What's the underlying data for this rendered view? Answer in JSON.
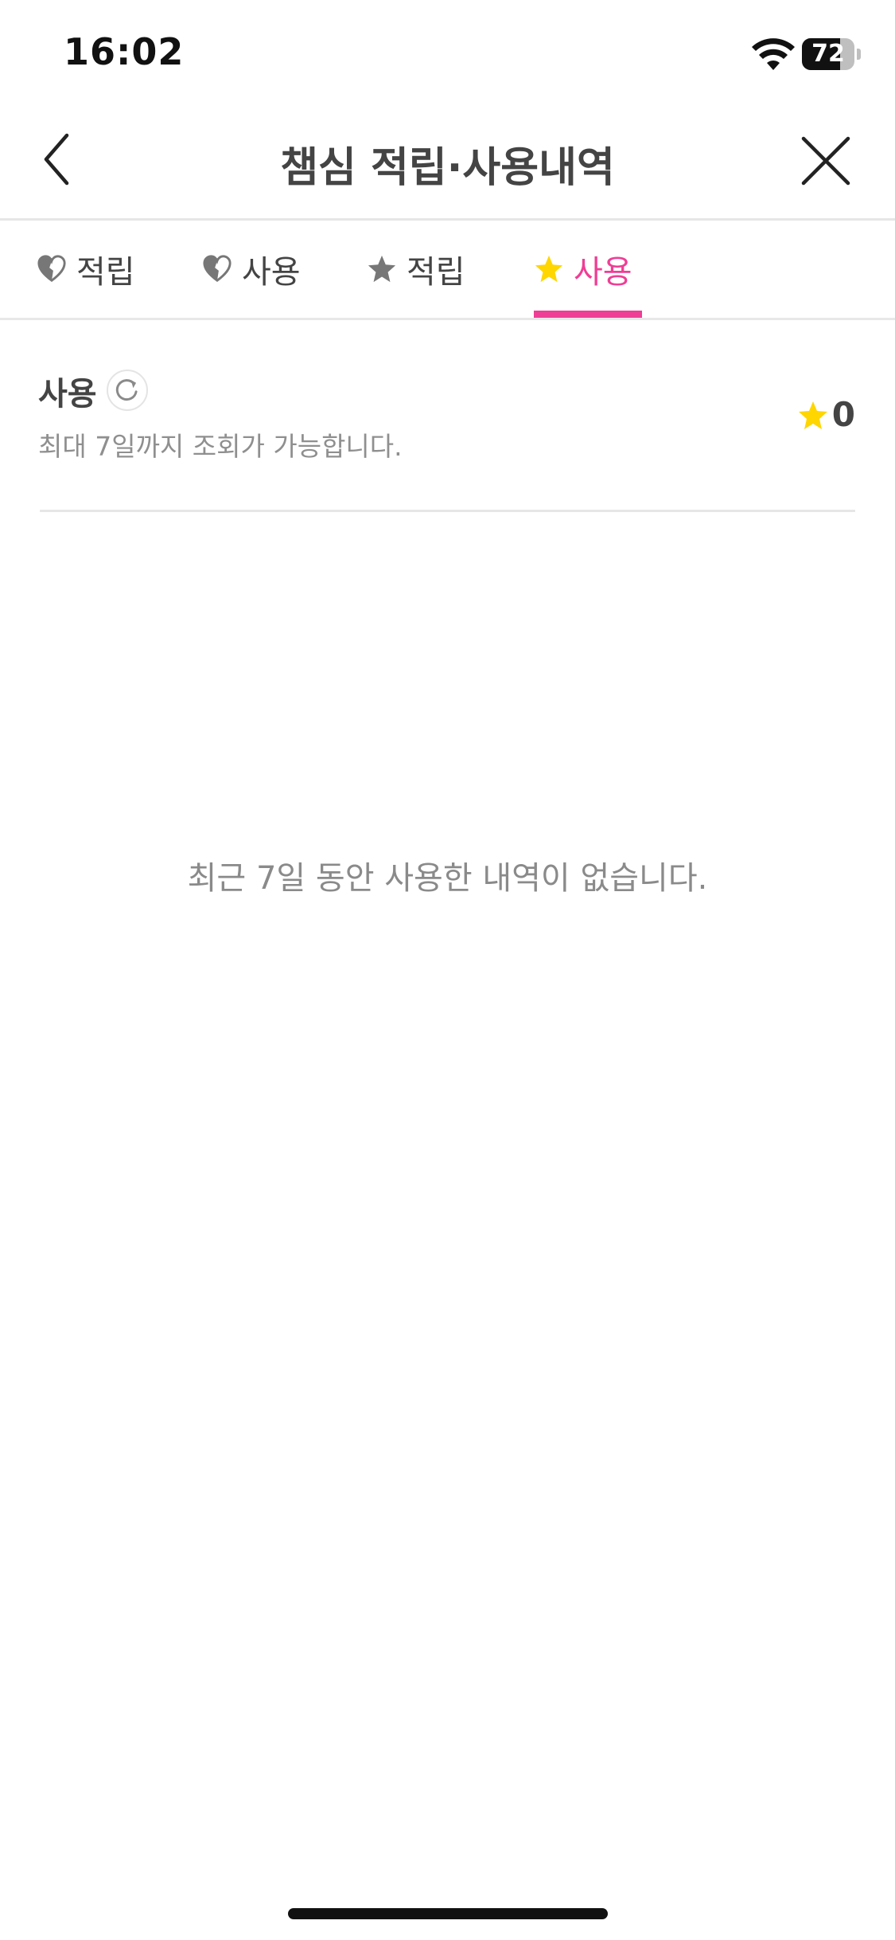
{
  "status_bar": {
    "time": "16:02",
    "battery_level": "72",
    "battery_fraction": 0.72
  },
  "header": {
    "title": "챔심 적립·사용내역",
    "back_icon": "chevron-left-icon",
    "close_icon": "close-icon"
  },
  "tabs": [
    {
      "label": "적립",
      "icon": "half-heart-icon",
      "active": false
    },
    {
      "label": "사용",
      "icon": "half-heart-icon",
      "active": false
    },
    {
      "label": "적립",
      "icon": "star-icon",
      "active": false
    },
    {
      "label": "사용",
      "icon": "star-icon",
      "active": true
    }
  ],
  "summary": {
    "title": "사용",
    "subtitle": "최대 7일까지 조회가 가능합니다.",
    "balance": "0",
    "refresh_icon": "refresh-icon",
    "balance_icon": "star-icon"
  },
  "empty_message": "최근 7일 동안 사용한 내역이 없습니다.",
  "colors": {
    "accent": "#ef3e95",
    "star_active": "#ffd600",
    "icon_gray": "#777777",
    "text": "#444444",
    "subtext": "#8f8f8f"
  }
}
